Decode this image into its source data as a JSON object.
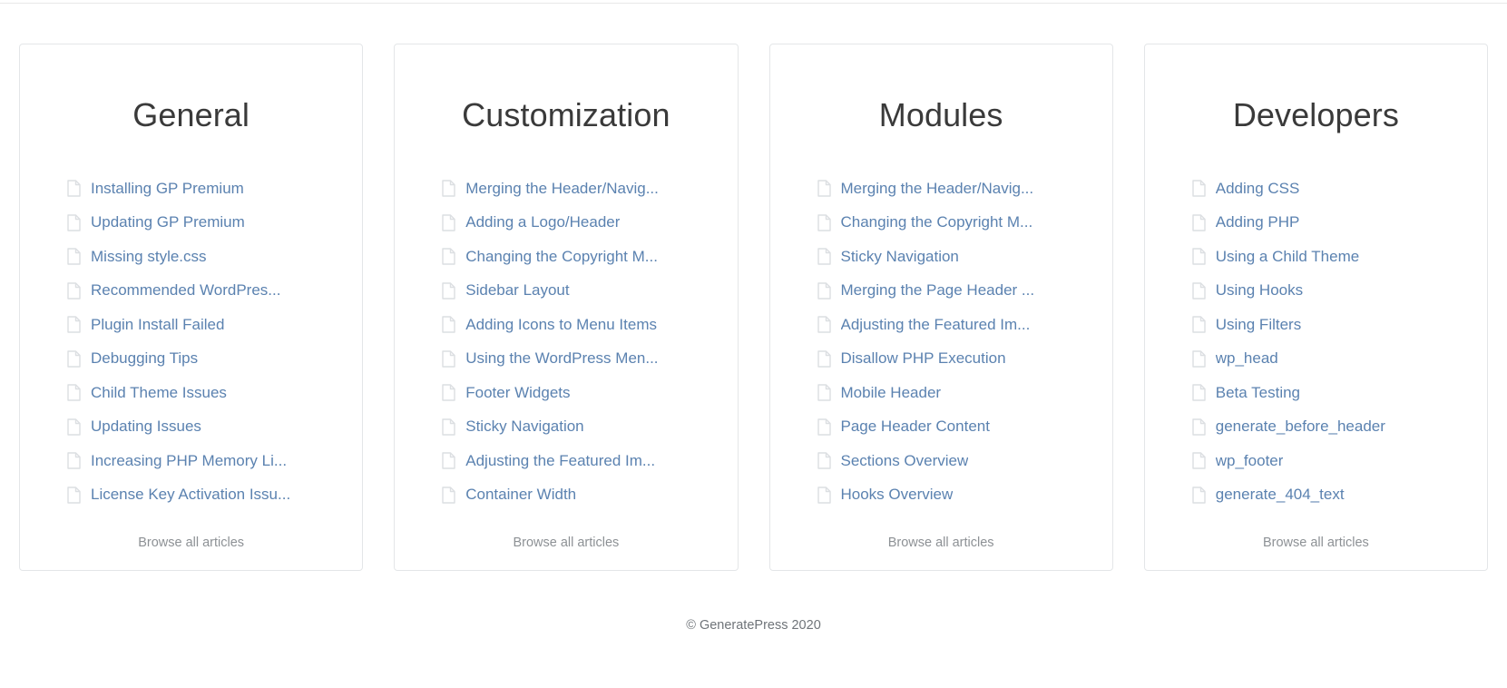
{
  "theme": {
    "link_color": "#5b82b0",
    "heading_color": "#3a3a3a",
    "muted_color": "#8d9195",
    "border_color": "#e4e6e8",
    "background": "#ffffff"
  },
  "icons": {
    "document": "document-icon"
  },
  "cards": [
    {
      "title": "General",
      "browse_label": "Browse all articles",
      "items": [
        "Installing GP Premium",
        "Updating GP Premium",
        "Missing style.css",
        "Recommended WordPres...",
        "Plugin Install Failed",
        "Debugging Tips",
        "Child Theme Issues",
        "Updating Issues",
        "Increasing PHP Memory Li...",
        "License Key Activation Issu..."
      ]
    },
    {
      "title": "Customization",
      "browse_label": "Browse all articles",
      "items": [
        "Merging the Header/Navig...",
        "Adding a Logo/Header",
        "Changing the Copyright M...",
        "Sidebar Layout",
        "Adding Icons to Menu Items",
        "Using the WordPress Men...",
        "Footer Widgets",
        "Sticky Navigation",
        "Adjusting the Featured Im...",
        "Container Width"
      ]
    },
    {
      "title": "Modules",
      "browse_label": "Browse all articles",
      "items": [
        "Merging the Header/Navig...",
        "Changing the Copyright M...",
        "Sticky Navigation",
        "Merging the Page Header ...",
        "Adjusting the Featured Im...",
        "Disallow PHP Execution",
        "Mobile Header",
        "Page Header Content",
        "Sections Overview",
        "Hooks Overview"
      ]
    },
    {
      "title": "Developers",
      "browse_label": "Browse all articles",
      "items": [
        "Adding CSS",
        "Adding PHP",
        "Using a Child Theme",
        "Using Hooks",
        "Using Filters",
        "wp_head",
        "Beta Testing",
        "generate_before_header",
        "wp_footer",
        "generate_404_text"
      ]
    }
  ],
  "footer": {
    "copyright": "© GeneratePress 2020"
  }
}
